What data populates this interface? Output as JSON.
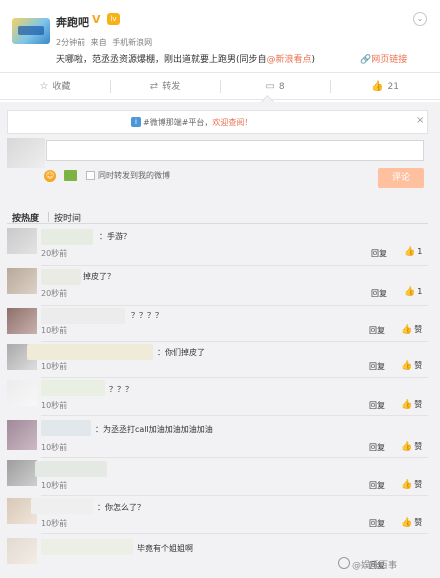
{
  "post": {
    "author": "奔跑吧",
    "verified_badge": "V",
    "level_badge": "lv",
    "time": "2分钟前",
    "source_prefix": "来自",
    "source": "手机新浪网",
    "text_main": "天哪啦，范丞丞资源爆棚，刚出道就要上跑男(同步自",
    "text_link": "@新浪看点",
    "text_end": ")",
    "web_link": "网页链接",
    "menu_icon": "chevron-down-icon"
  },
  "actions": {
    "favorite": "收藏",
    "repost": "转发",
    "comments_count": "8",
    "likes_count": "21"
  },
  "comment_box": {
    "notice_text": "#微博那端#平台，",
    "notice_link": "欢迎查阅！",
    "notice_close": "×",
    "repost_checkbox_label": "同时转发到我的微博",
    "submit_label": "评论"
  },
  "sort": {
    "hot": "按热度",
    "time": "按时间"
  },
  "comments": [
    {
      "text": "：手游？",
      "time": "20秒前",
      "reply": "回复",
      "likes": "1"
    },
    {
      "text": "掉皮了？",
      "time": "20秒前",
      "reply": "回复",
      "likes": "1"
    },
    {
      "text": "？？？？",
      "time": "10秒前",
      "reply": "回复",
      "likes": "赞"
    },
    {
      "text": "：你们掉皮了",
      "time": "10秒前",
      "reply": "回复",
      "likes": "赞"
    },
    {
      "text": "？？？",
      "time": "10秒前",
      "reply": "回复",
      "likes": "赞"
    },
    {
      "text": "：为丞丞打call加油加油加油加油",
      "time": "10秒前",
      "reply": "回复",
      "likes": "赞"
    },
    {
      "text": "",
      "time": "10秒前",
      "reply": "回复",
      "likes": "赞"
    },
    {
      "text": "：你怎么了？",
      "time": "10秒前",
      "reply": "回复",
      "likes": "赞"
    },
    {
      "text": "毕竟有个姐姐啊",
      "time": "",
      "reply": "回复",
      "likes": ""
    }
  ],
  "watermark": "@娱乐百事"
}
